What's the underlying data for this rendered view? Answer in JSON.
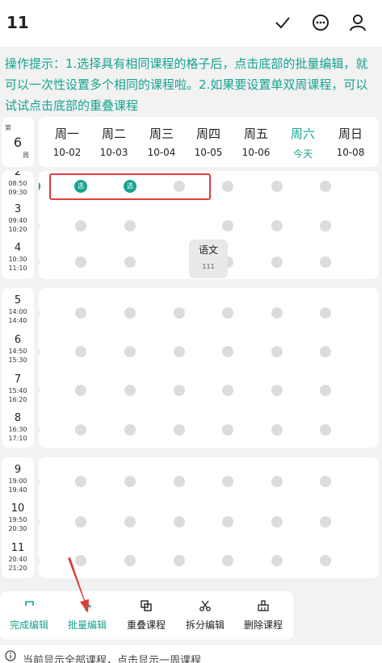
{
  "topbar": {
    "title": "11",
    "icons": [
      "check-icon",
      "chat-icon",
      "user-icon"
    ]
  },
  "hint": "操作提示：1.选择具有相同课程的格子后，点击底部的批量编辑，就可以一次性设置多个相同的课程啦。2.如果要设置单双周课程，可以试试点击底部的重叠课程",
  "week": {
    "prefix": "第",
    "number": "6",
    "suffix": "周"
  },
  "days": [
    {
      "name": "周一",
      "date": "10-02"
    },
    {
      "name": "周二",
      "date": "10-03"
    },
    {
      "name": "周三",
      "date": "10-04"
    },
    {
      "name": "周四",
      "date": "10-05"
    },
    {
      "name": "周五",
      "date": "10-06"
    },
    {
      "name": "周六",
      "date": "今天",
      "today": true
    },
    {
      "name": "周日",
      "date": "10-08"
    }
  ],
  "colors": {
    "accent": "#17a38f",
    "selection_box": "#e03b3b"
  },
  "slots": {
    "s2": {
      "num": "2",
      "start": "08:50",
      "end": "09:30"
    },
    "s3": {
      "num": "3",
      "start": "09:40",
      "end": "10:20"
    },
    "s4": {
      "num": "4",
      "start": "10:30",
      "end": "11:10"
    },
    "s5": {
      "num": "5",
      "start": "14:00",
      "end": "14:40"
    },
    "s6": {
      "num": "6",
      "start": "14:50",
      "end": "15:30"
    },
    "s7": {
      "num": "7",
      "start": "15:40",
      "end": "16:20"
    },
    "s8": {
      "num": "8",
      "start": "16:30",
      "end": "17:10"
    },
    "s9": {
      "num": "9",
      "start": "19:00",
      "end": "19:40"
    },
    "s10": {
      "num": "10",
      "start": "19:50",
      "end": "20:30"
    },
    "s11": {
      "num": "11",
      "start": "20:40",
      "end": "21:20"
    }
  },
  "selected_label": "选",
  "course": {
    "name": "语文",
    "room": "111"
  },
  "toolbar": {
    "done": "完成编辑",
    "batch": "批量编辑",
    "overlap": "重叠课程",
    "split": "拆分编辑",
    "delete": "删除课程"
  },
  "footer": {
    "text": "当前显示全部课程，点击显示一周课程"
  }
}
